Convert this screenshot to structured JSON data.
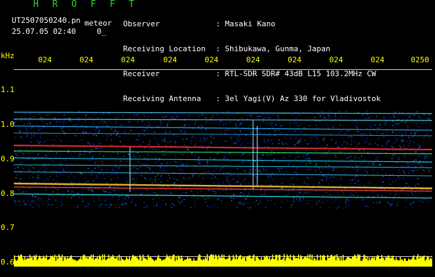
{
  "app": {
    "title": "H R O F F T"
  },
  "file": {
    "name": "UT2507050240.pn",
    "meteor_label": "meteor",
    "datetime": "25.07.05 02:40",
    "count": "0_"
  },
  "meta": {
    "labels": [
      "Observer",
      "Receiving Location",
      "Receiver",
      "Receiving Antenna"
    ],
    "values": [
      ": Masaki Kano",
      ": Shibukawa, Gunma, Japan",
      ": RTL-SDR SDR# 43dB L15 103.2MHz CW",
      ": 3el Yagi(V) Az 330 for Vladivostok"
    ]
  },
  "axis": {
    "unit": "kHz",
    "y_ticks": [
      "1.1",
      "1.0",
      "0.9",
      "0.8",
      "0.7",
      "0.6"
    ],
    "x_ticks": [
      "024",
      "024",
      "024",
      "024",
      "024",
      "024",
      "024",
      "024",
      "024",
      "0250"
    ]
  },
  "colors": {
    "text": "#ffffff",
    "axis": "#ffff00",
    "background": "#000000",
    "histogram": "#ffff00"
  }
}
